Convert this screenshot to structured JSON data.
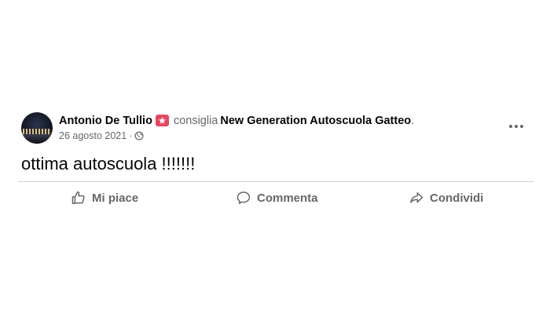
{
  "post": {
    "author_name": "Antonio De Tullio",
    "badge_icon": "star-badge-icon",
    "recommends_text": "consiglia",
    "page_name": "New Generation Autoscuola Gatteo",
    "page_name_suffix": ".",
    "date": "26 agosto 2021",
    "meta_separator": "·",
    "privacy_icon": "globe-icon",
    "body_text": "ottima autoscuola !!!!!!!",
    "colors": {
      "text_primary": "#050505",
      "text_secondary": "#65676b",
      "badge": "#f3425f",
      "divider": "#ced0d4"
    }
  },
  "actions": {
    "like_label": "Mi piace",
    "comment_label": "Commenta",
    "share_label": "Condividi"
  }
}
